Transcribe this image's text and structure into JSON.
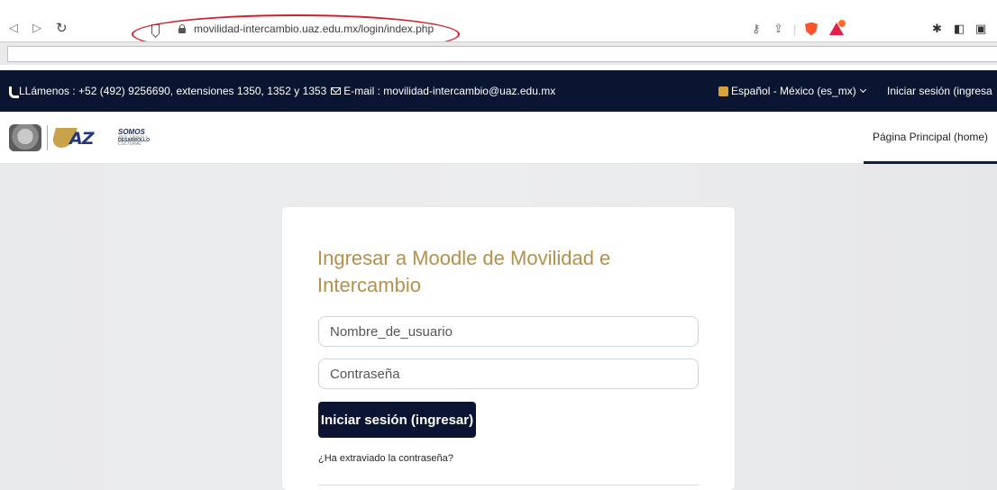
{
  "browser": {
    "url": "movilidad-intercambio.uaz.edu.mx/login/index.php",
    "back_icon": "back-arrow-icon",
    "forward_icon": "forward-arrow-icon",
    "reload_icon": "reload-icon",
    "highlight_color": "#d0202a"
  },
  "topbar": {
    "contact_text": "LLámenos : +52 (492) 9256690, extensiones 1350, 1352 y 1353",
    "email_text": "E-mail : movilidad-intercambio@uaz.edu.mx",
    "language": "Español - México (es_mx)",
    "login_link": "Iniciar sesión (ingresa",
    "background": "#0a1631"
  },
  "header": {
    "home_tab": "Página Principal (home)",
    "logo_somos": "SOMOS",
    "logo_desarrollo": "DESARROLLO",
    "logo_cultural": "CULTURAL"
  },
  "login": {
    "title": "Ingresar a Moodle de Movilidad e Intercambio",
    "username_placeholder": "Nombre_de_usuario",
    "password_placeholder": "Contraseña",
    "submit_label": "Iniciar sesión (ingresar)",
    "forgot_link": "¿Ha extraviado la contraseña?",
    "title_color": "#b6904a",
    "button_color": "#0b1533"
  }
}
